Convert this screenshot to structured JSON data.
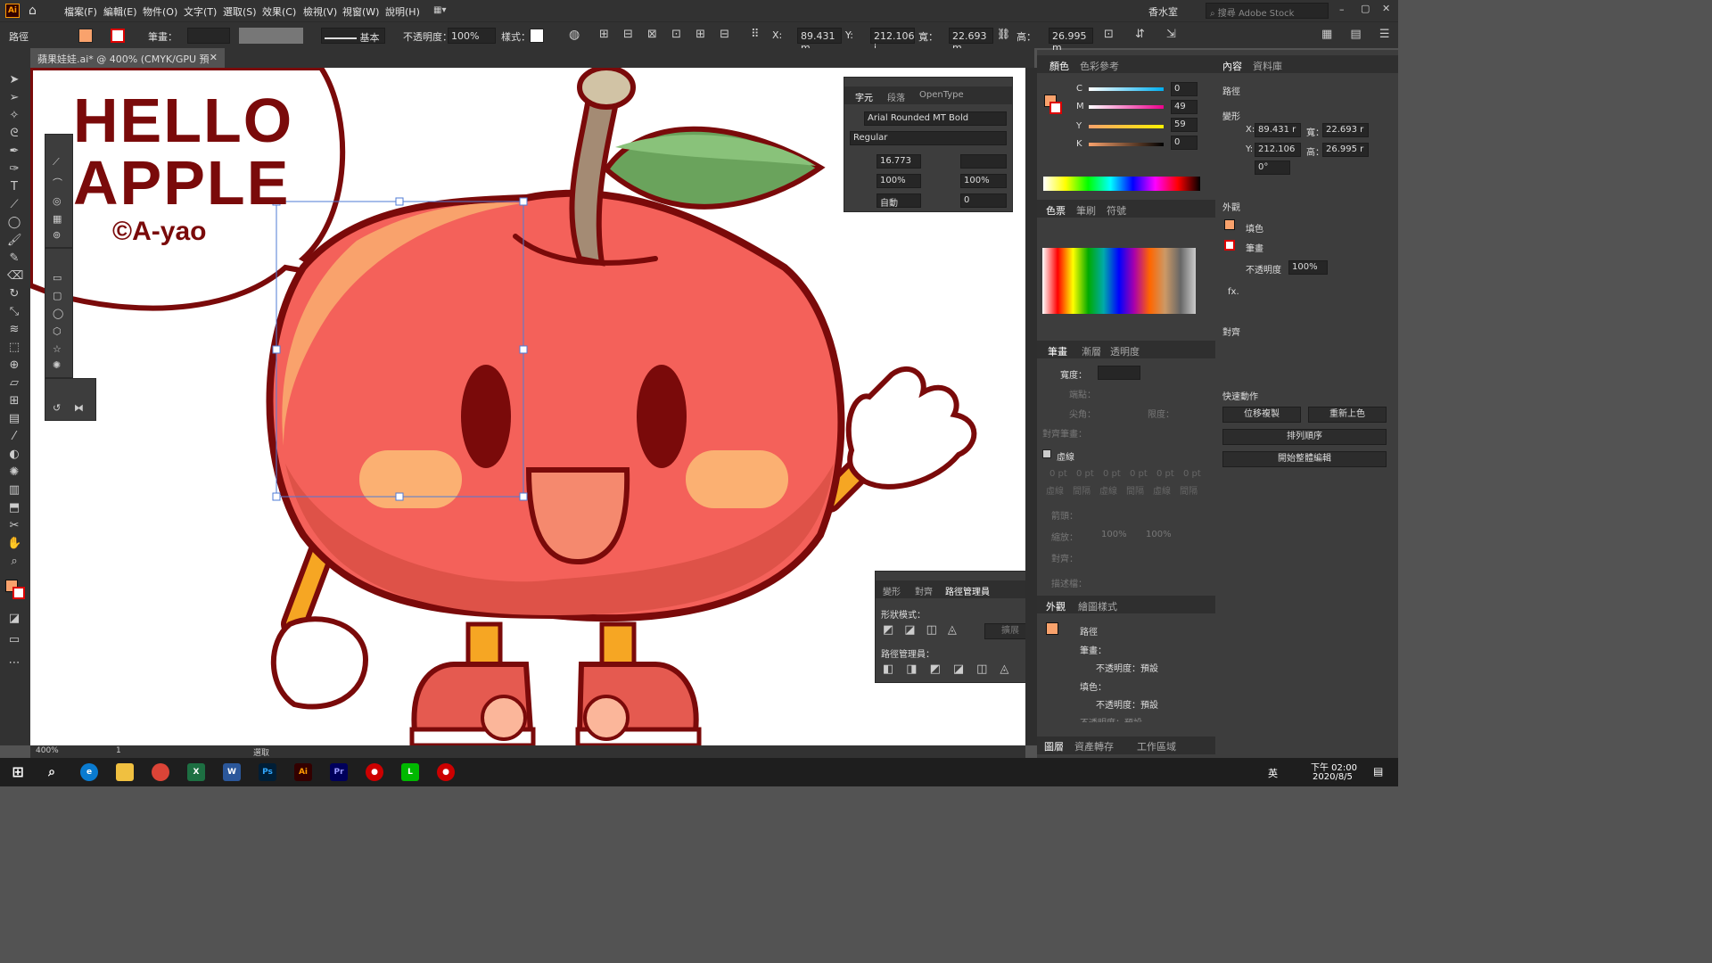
{
  "app": {
    "logo": "Ai"
  },
  "menu": [
    "檔案(F)",
    "編輯(E)",
    "物件(O)",
    "文字(T)",
    "選取(S)",
    "效果(C)",
    "檢視(V)",
    "視窗(W)",
    "說明(H)"
  ],
  "workspace": "香水室",
  "search_placeholder": "搜尋 Adobe Stock",
  "control": {
    "object_type": "路徑",
    "stroke_label": "筆畫：",
    "stroke_style": "基本",
    "opacity_label": "不透明度：",
    "opacity": "100%",
    "style_label": "樣式：",
    "x_label": "X:",
    "x": "89.431 m",
    "y_label": "Y:",
    "y": "212.106 i",
    "w_label": "寬：",
    "w": "22.693 m",
    "h_label": "高：",
    "h": "26.995 m"
  },
  "document": {
    "tab": "蘋果娃娃.ai* @ 400% (CMYK/GPU 預視)",
    "zoom": "400%",
    "page": "1",
    "status": "選取"
  },
  "artwork": {
    "line1": "HELLO",
    "line2": "APPLE",
    "line3": "©A-yao"
  },
  "character_panel": {
    "tabs": [
      "字元",
      "段落",
      "OpenType"
    ],
    "font": "Arial Rounded MT Bold",
    "style": "Regular",
    "size": "16.773",
    "leading": "",
    "scale_v": "100%",
    "scale_h": "100%",
    "kerning": "自動",
    "tracking": "0"
  },
  "color_panel": {
    "tabs": [
      "顏色",
      "色彩參考"
    ],
    "c": "0",
    "m": "49",
    "y": "59",
    "k": "0",
    "c_label": "C",
    "m_label": "M",
    "y_label": "Y",
    "k_label": "K",
    "pct": "%"
  },
  "swatch_panel": {
    "tabs": [
      "色票",
      "筆刷",
      "符號"
    ]
  },
  "stroke_panel": {
    "tabs": [
      "筆畫",
      "漸層",
      "透明度"
    ],
    "weight_label": "寬度：",
    "dashed_label": "虛線",
    "cap": "端點：",
    "corner": "尖角：",
    "limit": "限度：",
    "align": "對齊筆畫：",
    "dash_vals": [
      "0 pt",
      "0 pt",
      "0 pt",
      "0 pt",
      "0 pt",
      "0 pt"
    ],
    "dash_labels": [
      "虛線",
      "間隔",
      "虛線",
      "間隔",
      "虛線",
      "間隔"
    ],
    "arrow_label": "箭頭：",
    "scale_label": "縮放：",
    "scale1": "100%",
    "scale2": "100%",
    "align_label": "對齊：",
    "profile_label": "描述檔："
  },
  "appearance_panel": {
    "tabs": [
      "外觀",
      "繪圖樣式"
    ],
    "title": "路徑",
    "stroke": "筆畫：",
    "stroke_opacity": "不透明度：預設",
    "fill": "填色：",
    "fill_opacity": "不透明度：預設",
    "opacity_tail": "不透明度：預設"
  },
  "bottom_tabs": [
    "圖層",
    "資產轉存",
    "工作區域"
  ],
  "pathfinder_panel": {
    "tabs": [
      "變形",
      "對齊",
      "路徑管理員"
    ],
    "shape_modes": "形狀模式：",
    "pathfinders": "路徑管理員：",
    "expand": "擴展"
  },
  "properties": {
    "tabs": [
      "內容",
      "資料庫"
    ],
    "object": "路徑",
    "transform": "變形",
    "x_label": "X:",
    "x": "89.431 r",
    "y_label": "Y:",
    "y": "212.106",
    "w_label": "寬：",
    "w": "22.693 r",
    "h_label": "高：",
    "h": "26.995 r",
    "angle": "0°",
    "appearance": "外觀",
    "fill": "填色",
    "stroke": "筆畫",
    "opacity": "不透明度",
    "opacity_val": "100%",
    "fx": "fx.",
    "align": "對齊",
    "quick": "快速動作",
    "btn_offset": "位移複製",
    "btn_recolor": "重新上色",
    "btn_arrange": "排列順序",
    "btn_isolate": "開始整體編輯"
  },
  "taskbar": {
    "time": "下午 02:00",
    "date": "2020/8/5",
    "ime": "英"
  },
  "colors": {
    "accent": "#f9a26c",
    "apple": "#f4615a",
    "outline": "#7a0a0a",
    "leaf": "#6aa35c"
  }
}
